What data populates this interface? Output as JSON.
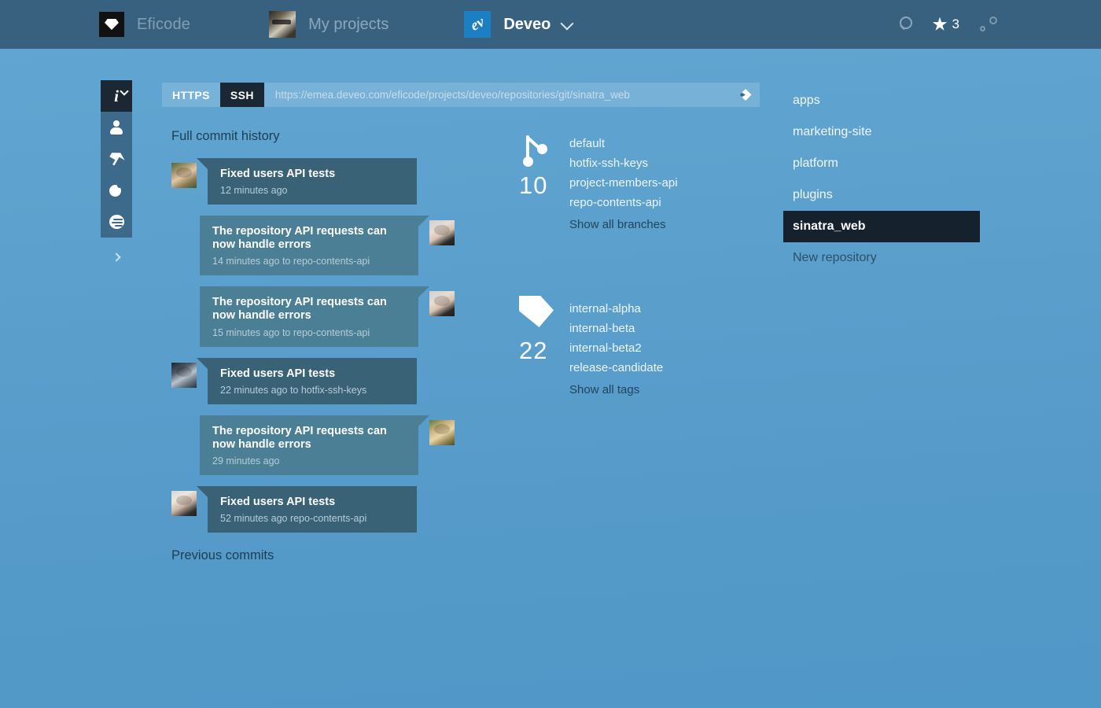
{
  "topbar": {
    "org": {
      "name": "Eficode",
      "logo_icon": "gem-logo-icon"
    },
    "projects": {
      "label": "My projects",
      "avatar_icon": "user-avatar"
    },
    "current": {
      "label": "Deveo",
      "logo_text": "ev",
      "chevron_icon": "chevron-down-icon"
    },
    "actions": {
      "search_icon": "search-icon",
      "star_icon": "star-icon",
      "star_count": "3",
      "settings_icon": "gear-icon"
    }
  },
  "rail": {
    "items": [
      {
        "name": "info",
        "icon": "info-icon",
        "glyph": "i",
        "active": true
      },
      {
        "name": "members",
        "icon": "person-icon",
        "active": false
      },
      {
        "name": "push",
        "icon": "arrow-icon",
        "active": false
      },
      {
        "name": "commits",
        "icon": "commit-icon",
        "active": false
      },
      {
        "name": "activity",
        "icon": "stack-icon",
        "active": false
      }
    ],
    "expand_icon": "chevron-right-icon"
  },
  "urlbar": {
    "protocols": [
      {
        "label": "HTTPS",
        "selected": false
      },
      {
        "label": "SSH",
        "selected": true
      }
    ],
    "url": "https://emea.deveo.com/eficode/projects/deveo/repositories/git/sinatra_web",
    "copy_icon": "copy-diamond-icon"
  },
  "history": {
    "heading": "Full commit history",
    "previous_label": "Previous commits",
    "commits": [
      {
        "title": "Fixed users API tests",
        "meta": "12 minutes ago",
        "side": "left",
        "tone": "dark",
        "width": "c-w1",
        "avatar": "av-a"
      },
      {
        "title": "The repository API requests can now handle errors",
        "meta": "14 minutes ago to repo-contents-api",
        "side": "right",
        "tone": "mid",
        "width": "c-w2",
        "avatar": "av-b"
      },
      {
        "title": "The repository API requests can now handle errors",
        "meta": "15 minutes ago to repo-contents-api",
        "side": "right",
        "tone": "mid",
        "width": "c-w2",
        "avatar": "av-b"
      },
      {
        "title": "Fixed users API tests",
        "meta": "22 minutes ago to hotfix-ssh-keys",
        "side": "left",
        "tone": "dark",
        "width": "c-w1",
        "avatar": "av-c"
      },
      {
        "title": "The repository API requests can now handle errors",
        "meta": "29 minutes ago",
        "side": "right",
        "tone": "mid",
        "width": "c-w2",
        "avatar": "av-d"
      },
      {
        "title": "Fixed users API tests",
        "meta": "52 minutes ago repo-contents-api",
        "side": "left",
        "tone": "dark",
        "width": "c-w1",
        "avatar": "av-e"
      }
    ]
  },
  "refs": {
    "branches": {
      "icon": "branch-icon",
      "count": "10",
      "items": [
        "default",
        "hotfix-ssh-keys",
        "project-members-api",
        "repo-contents-api"
      ],
      "show_all": "Show all branches"
    },
    "tags": {
      "icon": "tag-icon",
      "count": "22",
      "items": [
        "internal-alpha",
        "internal-beta",
        "internal-beta2",
        "release-candidate"
      ],
      "show_all": "Show all tags"
    }
  },
  "repositories": {
    "items": [
      {
        "label": "apps",
        "state": "normal"
      },
      {
        "label": "marketing-site",
        "state": "normal"
      },
      {
        "label": "platform",
        "state": "normal"
      },
      {
        "label": "plugins",
        "state": "normal"
      },
      {
        "label": "sinatra_web",
        "state": "active"
      },
      {
        "label": "New repository",
        "state": "muted"
      }
    ]
  },
  "colors": {
    "topbar": "#386180",
    "background_top": "#62a6d3",
    "background_bottom": "#5098c8",
    "active_dark": "#15222e",
    "bubble_dark": "#3a6277",
    "bubble_mid": "#4b7f95",
    "brand_blue": "#1c7fc4"
  }
}
